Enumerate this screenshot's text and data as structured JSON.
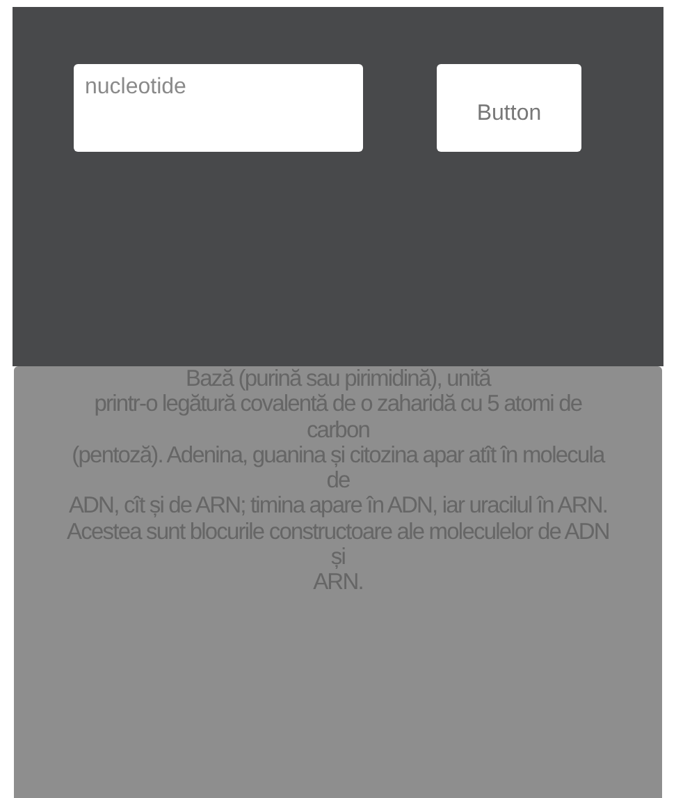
{
  "search": {
    "placeholder": "nucleotide"
  },
  "button": {
    "label": "Button"
  },
  "description": "Bază (purină sau pirimidină), unită\nprintr-o legătură covalentă de o zaharidă cu 5 atomi de\ncarbon\n(pentoză). Adenina, guanina și citozina apar atît în molecula\nde\nADN, cît și de ARN; timina apare în ADN, iar uracilul în ARN.\nAcestea sunt blocurile constructoare ale moleculelor de ADN\nși\nARN."
}
